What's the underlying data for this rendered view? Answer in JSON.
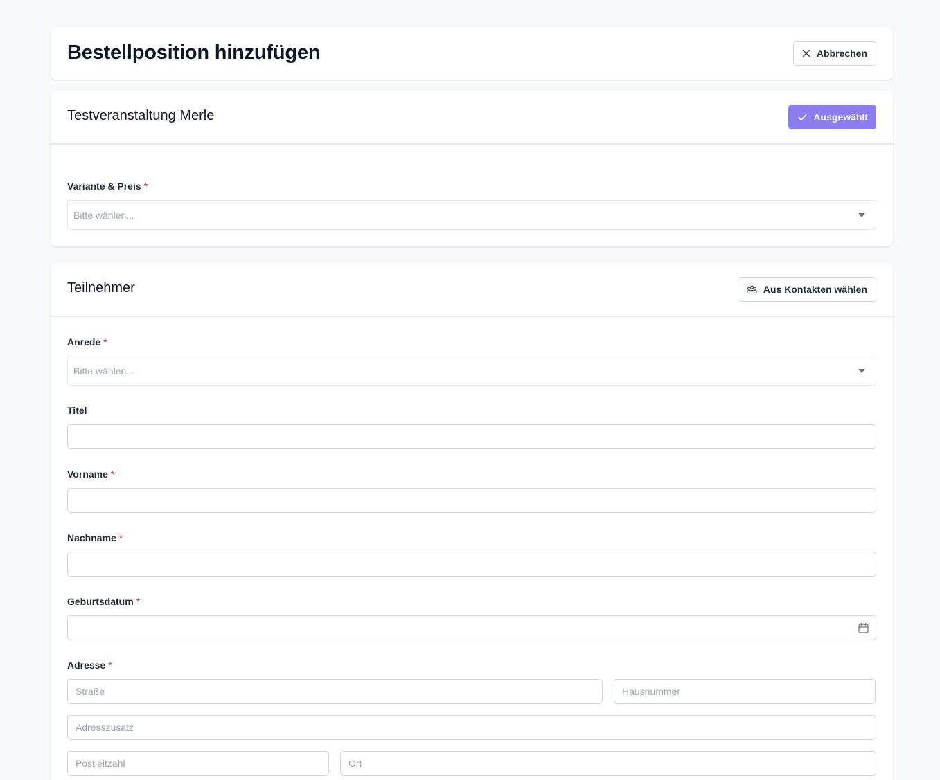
{
  "header": {
    "title": "Bestellposition hinzufügen",
    "cancel_label": "Abbrechen"
  },
  "event": {
    "name": "Testveranstaltung Merle",
    "selected_label": "Ausgewählt",
    "variant_label": "Variante & Preis",
    "variant_placeholder": "Bitte wählen..."
  },
  "participant": {
    "title": "Teilnehmer",
    "contacts_label": "Aus Kontakten wählen",
    "required_marker": "*",
    "salutation_label": "Anrede",
    "salutation_placeholder": "Bitte wählen...",
    "title_label": "Titel",
    "title_value": "",
    "firstname_label": "Vorname",
    "firstname_value": "",
    "lastname_label": "Nachname",
    "lastname_value": "",
    "birthdate_label": "Geburtsdatum",
    "birthdate_value": "",
    "address_label": "Adresse",
    "street_placeholder": "Straße",
    "housenumber_placeholder": "Hausnummer",
    "address_extra_placeholder": "Adresszusatz",
    "zip_placeholder": "Postleitzahl",
    "city_placeholder": "Ort"
  },
  "colors": {
    "accent": "#8b7cf0",
    "required": "#dc2626",
    "background": "#f8f9fb"
  },
  "icons": {
    "cancel": "close-icon",
    "selected": "check-icon",
    "contacts": "users-icon",
    "dropdown": "chevron-down-icon",
    "date": "calendar-icon"
  }
}
